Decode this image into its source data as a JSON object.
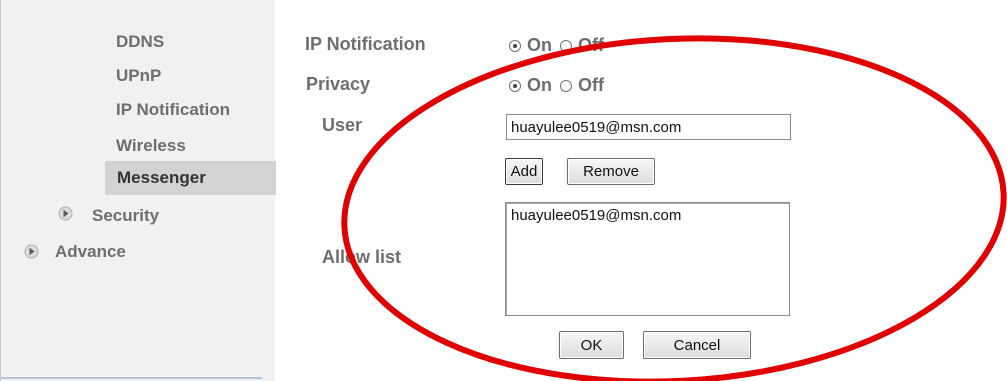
{
  "sidebar": {
    "items": [
      {
        "label": "DDNS"
      },
      {
        "label": "UPnP"
      },
      {
        "label": "IP Notification"
      },
      {
        "label": "Wireless"
      },
      {
        "label": "Messenger"
      }
    ],
    "groups": [
      {
        "label": "Security",
        "icon": "expand-arrow-icon"
      },
      {
        "label": "Advance",
        "icon": "expand-arrow-icon"
      }
    ]
  },
  "form": {
    "ip_notification": {
      "label": "IP Notification",
      "on": "On",
      "off": "Off",
      "selected": "On"
    },
    "privacy": {
      "label": "Privacy",
      "on": "On",
      "off": "Off",
      "selected": "On"
    },
    "user": {
      "label": "User",
      "value": "huayulee0519@msn.com"
    },
    "add_label": "Add",
    "remove_label": "Remove",
    "allow_list": {
      "label": "Allow list",
      "items": [
        "huayulee0519@msn.com"
      ]
    },
    "ok_label": "OK",
    "cancel_label": "Cancel"
  },
  "colors": {
    "annotation": "#e00000",
    "selected_item_bg": "#d3d3d3",
    "sidebar_bg": "#f1f1f1"
  }
}
